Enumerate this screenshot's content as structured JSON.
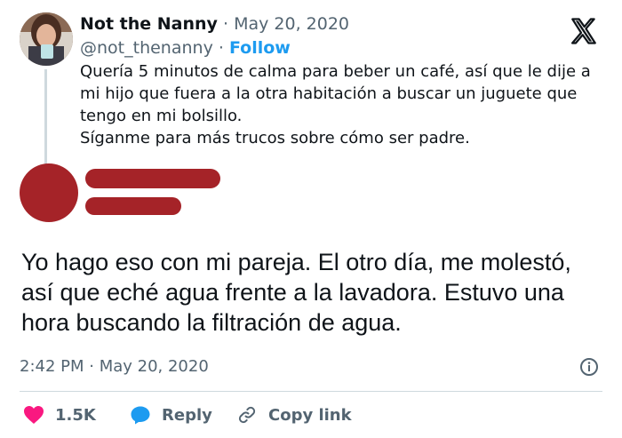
{
  "tweet": {
    "display_name": "Not the Nanny",
    "date": "May 20, 2020",
    "handle": "@not_thenanny",
    "follow_label": "Follow",
    "dot": "·",
    "text_lines": [
      "Quería 5 minutos de calma para beber un café, así que le dije a mi hijo que fuera a la otra habitación a buscar un juguete que tengo en mi bolsillo.",
      "Síganme para más trucos sobre cómo ser padre."
    ]
  },
  "reply": {
    "text": "Yo hago eso con mi pareja. El otro día, me molestó, así que eché agua frente a la lavadora. Estuvo una hora buscando la filtración de agua.",
    "timestamp": "2:42 PM · May 20, 2020",
    "redaction_color": "#a52328"
  },
  "actions": {
    "likes": "1.5K",
    "reply_label": "Reply",
    "copy_label": "Copy link",
    "like_color": "#f91880",
    "reply_color": "#1d9bf0"
  },
  "icons": [
    "x-logo-icon",
    "info-icon",
    "heart-icon",
    "reply-bubble-icon",
    "link-icon"
  ]
}
